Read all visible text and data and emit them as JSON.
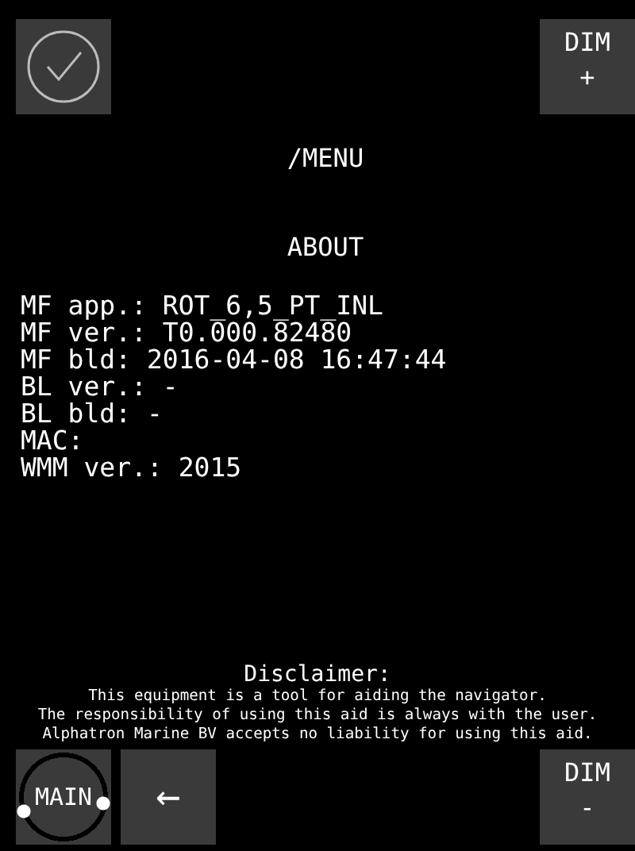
{
  "top_buttons": [
    {
      "kind": "confirm"
    },
    {
      "kind": "spacer"
    },
    {
      "kind": "text",
      "label": "DIM",
      "sub": "+"
    }
  ],
  "path": "/MENU",
  "title": "ABOUT",
  "info_lines": [
    "MF app.: ROT_6,5_PT_INL",
    "MF ver.: T0.000.82480",
    "MF bld: 2016-04-08 16:47:44",
    "BL ver.: -",
    "BL bld: -",
    "MAC:",
    "WMM ver.: 2015"
  ],
  "disclaimer": {
    "title": "Disclaimer:",
    "lines": [
      "This equipment is a tool for aiding the navigator.",
      "The responsibility of using this aid is always with the user.",
      "Alphatron Marine BV accepts no liability for using this aid."
    ]
  },
  "bottom_buttons": [
    {
      "kind": "main",
      "label": "MAIN"
    },
    {
      "kind": "back",
      "label": "←"
    },
    {
      "kind": "spacer"
    },
    {
      "kind": "text",
      "label": "DIM",
      "sub": "-"
    }
  ]
}
